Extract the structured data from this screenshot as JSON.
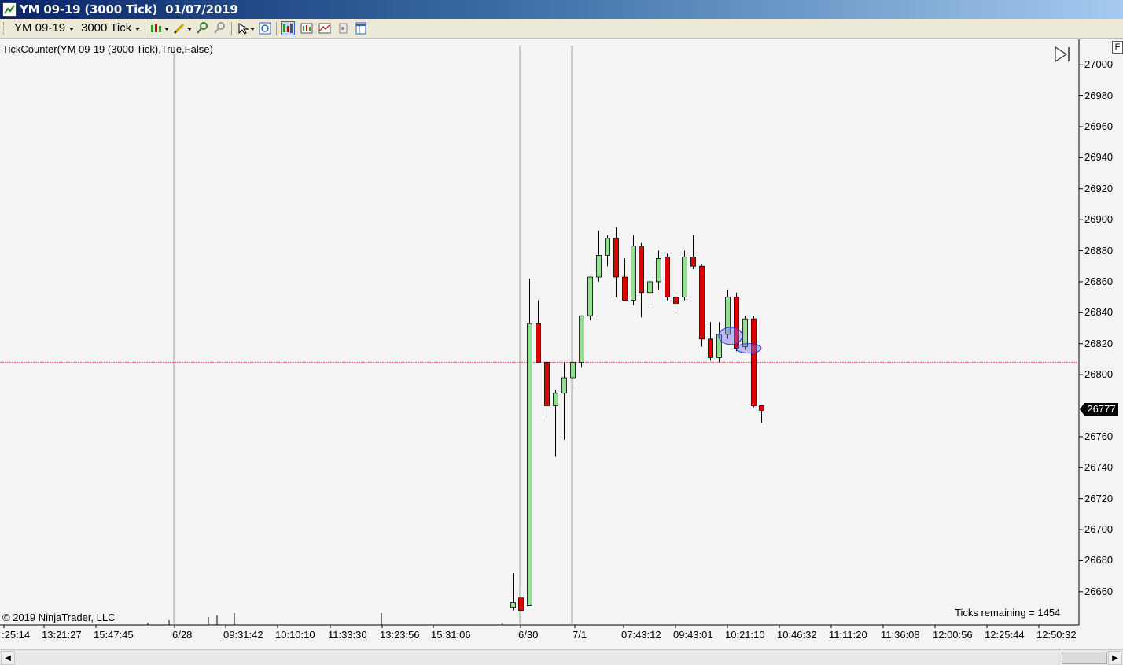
{
  "window": {
    "title": "YM 09-19 (3000 Tick)  01/07/2019"
  },
  "toolbar": {
    "instrument": "YM 09-19",
    "interval": "3000 Tick"
  },
  "chart": {
    "indicator_label": "TickCounter(YM  09-19 (3000 Tick),True,False)",
    "copyright": "© 2019 NinjaTrader, LLC",
    "ticks_remaining": "Ticks remaining = 1454",
    "last_price": "26777",
    "reference_price": 26808,
    "f_button": "F",
    "colors": {
      "up": "#90e090",
      "down": "#e00000",
      "wick": "#000000",
      "reference_line": "#e06060",
      "session_break": "#a0a0a0",
      "highlight_ellipse": "#3030d0"
    },
    "price_axis": [
      "27000",
      "26980",
      "26960",
      "26940",
      "26920",
      "26900",
      "26880",
      "26860",
      "26840",
      "26820",
      "26800",
      "26760",
      "26740",
      "26720",
      "26700",
      "26680",
      "26660"
    ],
    "time_axis": [
      ":25:14",
      "13:21:27",
      "15:47:45",
      "6/28",
      "09:31:42",
      "10:10:10",
      "11:33:30",
      "13:23:56",
      "15:31:06",
      "6/30",
      "7/1",
      "07:43:12",
      "09:43:01",
      "10:21:10",
      "10:46:32",
      "11:11:20",
      "11:36:08",
      "12:00:56",
      "12:25:44",
      "12:50:32"
    ]
  },
  "chart_data": {
    "type": "candlestick",
    "ylim": [
      26645,
      27005
    ],
    "candles": [
      {
        "o": 26650,
        "h": 26672,
        "l": 26648,
        "c": 26653
      },
      {
        "o": 26656,
        "h": 26660,
        "l": 26645,
        "c": 26648
      },
      {
        "o": 26651,
        "h": 26862,
        "l": 26651,
        "c": 26833
      },
      {
        "o": 26833,
        "h": 26848,
        "l": 26808,
        "c": 26808
      },
      {
        "o": 26808,
        "h": 26810,
        "l": 26772,
        "c": 26780
      },
      {
        "o": 26780,
        "h": 26790,
        "l": 26747,
        "c": 26788
      },
      {
        "o": 26788,
        "h": 26808,
        "l": 26758,
        "c": 26798
      },
      {
        "o": 26798,
        "h": 26808,
        "l": 26790,
        "c": 26808
      },
      {
        "o": 26808,
        "h": 26818,
        "l": 26805,
        "c": 26838
      },
      {
        "o": 26838,
        "h": 26860,
        "l": 26835,
        "c": 26863
      },
      {
        "o": 26863,
        "h": 26893,
        "l": 26860,
        "c": 26877
      },
      {
        "o": 26877,
        "h": 26890,
        "l": 26870,
        "c": 26888
      },
      {
        "o": 26888,
        "h": 26895,
        "l": 26850,
        "c": 26863
      },
      {
        "o": 26863,
        "h": 26875,
        "l": 26848,
        "c": 26848
      },
      {
        "o": 26848,
        "h": 26890,
        "l": 26845,
        "c": 26883
      },
      {
        "o": 26883,
        "h": 26885,
        "l": 26837,
        "c": 26853
      },
      {
        "o": 26853,
        "h": 26865,
        "l": 26845,
        "c": 26860
      },
      {
        "o": 26860,
        "h": 26880,
        "l": 26855,
        "c": 26875
      },
      {
        "o": 26876,
        "h": 26878,
        "l": 26848,
        "c": 26850
      },
      {
        "o": 26850,
        "h": 26853,
        "l": 26839,
        "c": 26846
      },
      {
        "o": 26850,
        "h": 26880,
        "l": 26848,
        "c": 26876
      },
      {
        "o": 26876,
        "h": 26890,
        "l": 26868,
        "c": 26870
      },
      {
        "o": 26870,
        "h": 26871,
        "l": 26818,
        "c": 26823
      },
      {
        "o": 26823,
        "h": 26834,
        "l": 26809,
        "c": 26811
      },
      {
        "o": 26811,
        "h": 26834,
        "l": 26808,
        "c": 26826
      },
      {
        "o": 26826,
        "h": 26855,
        "l": 26823,
        "c": 26850
      },
      {
        "o": 26850,
        "h": 26853,
        "l": 26815,
        "c": 26817
      },
      {
        "o": 26818,
        "h": 26838,
        "l": 26816,
        "c": 26836
      },
      {
        "o": 26836,
        "h": 26838,
        "l": 26779,
        "c": 26780
      },
      {
        "o": 26780,
        "h": 26780,
        "l": 26769,
        "c": 26777
      }
    ],
    "annotations": [
      {
        "shape": "ellipse",
        "price": 26825
      },
      {
        "shape": "ellipse",
        "price": 26817
      }
    ]
  }
}
